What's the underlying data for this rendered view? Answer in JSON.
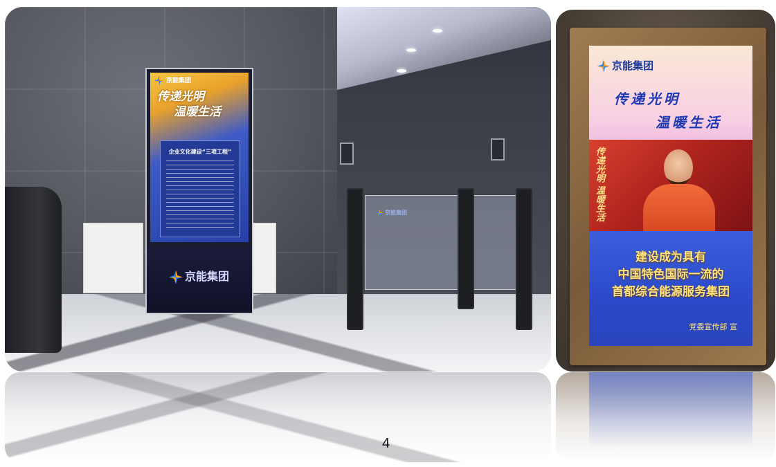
{
  "left_photo": {
    "standing_banner": {
      "logo_text": "京能集团",
      "calligraphy_line1": "传递光明",
      "calligraphy_line2": "温暖生活",
      "panel_title": "企业文化建设“三项工程”",
      "base_logo_text": "京能集团"
    },
    "gate_sign_text": "京能集团"
  },
  "right_photo": {
    "screen": {
      "logo_text": "京能集团",
      "calligraphy_line1": "传递光明",
      "calligraphy_line2": "温暖生活",
      "photo_calligraphy": "传递光明 温暖生活",
      "slogan_line1": "建设成为具有",
      "slogan_line2": "中国特色国际一流的",
      "slogan_line3": "首都综合能源服务集团",
      "sign_off": "党委宣传部 宣"
    }
  },
  "page_number": "4",
  "icons": [
    "jingneng-star-logo-icon"
  ]
}
